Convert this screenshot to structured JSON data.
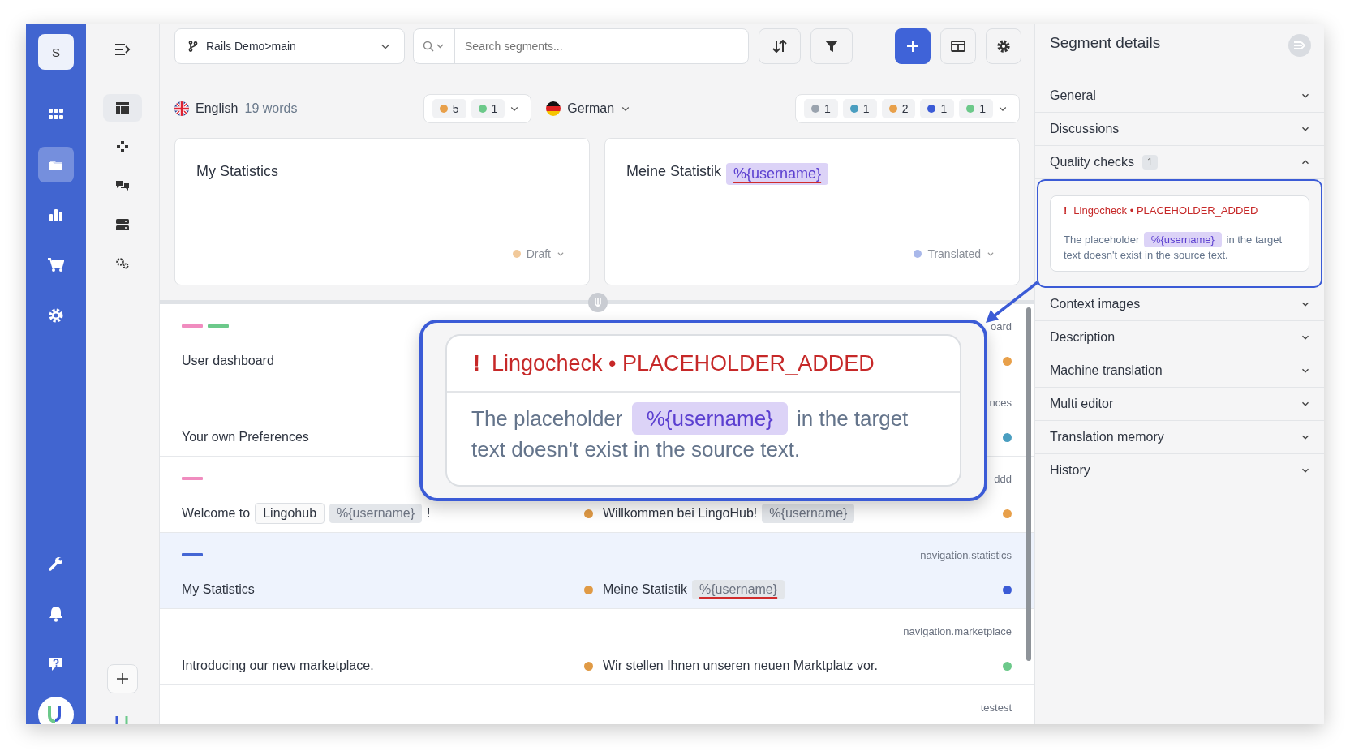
{
  "branch": {
    "label": "Rails Demo>main"
  },
  "search": {
    "placeholder": "Search segments..."
  },
  "source_lang": {
    "name": "English",
    "words": "19 words",
    "counts": [
      {
        "color": "#e8a04a",
        "count": "5"
      },
      {
        "color": "#6cc98a",
        "count": "1"
      }
    ]
  },
  "target_lang": {
    "name": "German",
    "counts": [
      {
        "color": "#9aa3ae",
        "count": "1"
      },
      {
        "color": "#4a9ec0",
        "count": "1"
      },
      {
        "color": "#e8a04a",
        "count": "2"
      },
      {
        "color": "#3b5bd6",
        "count": "1"
      },
      {
        "color": "#6cc98a",
        "count": "1"
      }
    ]
  },
  "source_card": {
    "segments": [
      {
        "kind": "text",
        "text": "My Statistics"
      }
    ],
    "status": "Draft",
    "status_dot": {
      "color": "#f1c99a"
    }
  },
  "target_card": {
    "segments": [
      {
        "kind": "text",
        "text": "Meine Statistik"
      },
      {
        "kind": "placeholder",
        "text": "%{username}",
        "highlighted": true,
        "error": true
      }
    ],
    "status": "Translated",
    "status_dot": {
      "color": "#a9b8ea"
    }
  },
  "rows": [
    {
      "selected": false,
      "tags": [
        {
          "color": "#f08cbf"
        },
        {
          "color": "#6cc98a"
        }
      ],
      "source": [
        {
          "kind": "text",
          "text": "User dashboard"
        }
      ],
      "key": "oard",
      "status_dot": {
        "color": "#e8a04a"
      }
    },
    {
      "selected": false,
      "tags": [],
      "source": [
        {
          "kind": "text",
          "text": "Your own Preferences"
        }
      ],
      "key": "nces",
      "status_dot": {
        "color": "#4a9ec0"
      }
    },
    {
      "selected": false,
      "tags": [
        {
          "color": "#f08cbf"
        }
      ],
      "source": [
        {
          "kind": "text",
          "text": "Welcome to"
        },
        {
          "kind": "tag",
          "text": "Lingohub"
        },
        {
          "kind": "placeholder",
          "text": "%{username}",
          "highlighted": false,
          "error": false
        },
        {
          "kind": "text",
          "text": "!"
        }
      ],
      "target_dot": {
        "color": "#e09a45"
      },
      "target": [
        {
          "kind": "text",
          "text": "Willkommen bei LingoHub!"
        },
        {
          "kind": "placeholder",
          "text": "%{username}",
          "highlighted": false,
          "error": false
        }
      ],
      "key": "ddd",
      "status_dot": {
        "color": "#e8a04a"
      }
    },
    {
      "selected": true,
      "tags": [
        {
          "color": "#4466d4"
        }
      ],
      "source": [
        {
          "kind": "text",
          "text": "My Statistics"
        }
      ],
      "target_dot": {
        "color": "#e09a45"
      },
      "target": [
        {
          "kind": "text",
          "text": "Meine Statistik"
        },
        {
          "kind": "placeholder",
          "text": "%{username}",
          "highlighted": false,
          "error": true
        }
      ],
      "key": "navigation.statistics",
      "status_dot": {
        "color": "#3b5bd6"
      }
    },
    {
      "selected": false,
      "tags": [],
      "source": [
        {
          "kind": "text",
          "text": "Introducing our new marketplace."
        }
      ],
      "target_dot": {
        "color": "#e09a45"
      },
      "target": [
        {
          "kind": "text",
          "text": "Wir stellen Ihnen unseren neuen Marktplatz vor."
        }
      ],
      "key": "navigation.marketplace",
      "status_dot": {
        "color": "#6cc98a"
      }
    },
    {
      "selected": false,
      "tags": [],
      "source": [],
      "key": "testest"
    }
  ],
  "panel": {
    "title": "Segment details",
    "sections": [
      {
        "label": "General",
        "expanded": false
      },
      {
        "label": "Discussions",
        "expanded": false
      },
      {
        "label": "Quality checks",
        "count": "1",
        "expanded": true,
        "check": {
          "mark": "!",
          "title": "Lingocheck • PLACEHOLDER_ADDED",
          "message": [
            {
              "kind": "text",
              "text": "The placeholder"
            },
            {
              "kind": "placeholder",
              "text": "%{username}",
              "highlighted": true,
              "error": false
            },
            {
              "kind": "text",
              "text": "in the target text doesn't exist in the source text."
            }
          ]
        }
      },
      {
        "label": "Context images",
        "expanded": false
      },
      {
        "label": "Description",
        "expanded": false
      },
      {
        "label": "Machine translation",
        "expanded": false
      },
      {
        "label": "Multi editor",
        "expanded": false
      },
      {
        "label": "Translation memory",
        "expanded": false
      },
      {
        "label": "History",
        "expanded": false
      }
    ]
  },
  "callout": {
    "mark": "!",
    "title": "Lingocheck • PLACEHOLDER_ADDED",
    "message": [
      {
        "kind": "text",
        "text": "The placeholder"
      },
      {
        "kind": "placeholder",
        "text": "%{username}",
        "highlighted": true,
        "error": false
      },
      {
        "kind": "text",
        "text": "in the target text doesn't exist in the source text."
      }
    ]
  },
  "user": {
    "initial": "S"
  }
}
